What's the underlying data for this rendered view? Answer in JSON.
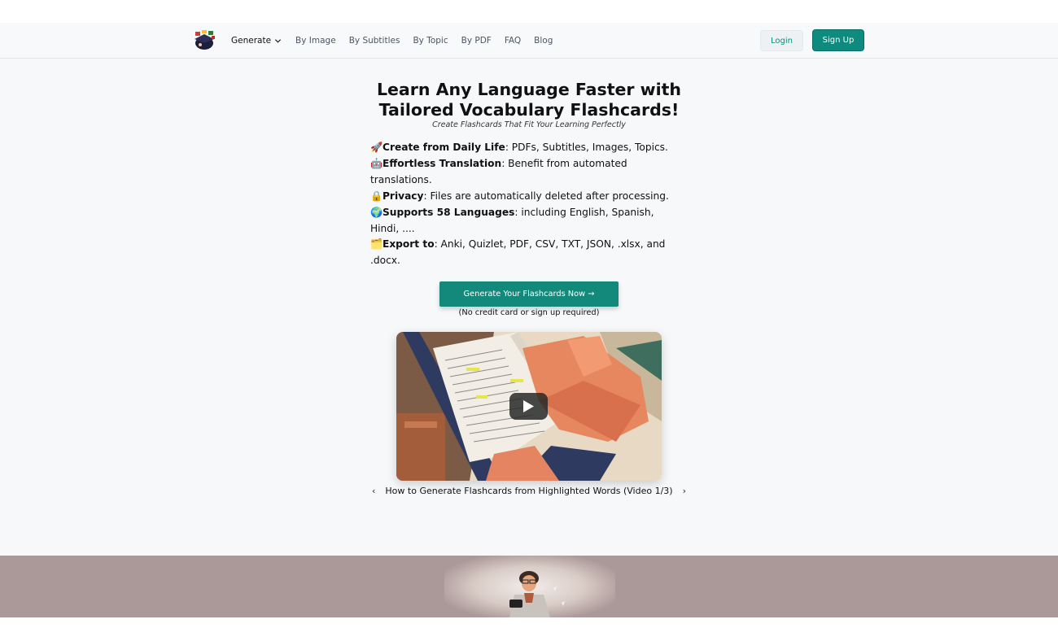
{
  "nav": {
    "generate_label": "Generate",
    "links": [
      "By Image",
      "By Subtitles",
      "By Topic",
      "By PDF",
      "FAQ",
      "Blog"
    ],
    "login_label": "Login",
    "signup_label": "Sign Up"
  },
  "hero": {
    "title_line1": "Learn Any Language Faster with",
    "title_line2": "Tailored Vocabulary Flashcards!",
    "subtitle": "Create Flashcards That Fit Your Learning Perfectly"
  },
  "features": [
    {
      "icon": "🚀",
      "icon_name": "rocket-icon",
      "bold": "Create from Daily Life",
      "text": ": PDFs, Subtitles, Images, Topics."
    },
    {
      "icon": "🤖",
      "icon_name": "robot-icon",
      "bold": "Effortless Translation",
      "text": ": Benefit from automated translations."
    },
    {
      "icon": "🔒",
      "icon_name": "lock-icon",
      "bold": "Privacy",
      "text": ": Files are automatically deleted after processing."
    },
    {
      "icon": "🌍",
      "icon_name": "globe-icon",
      "bold": "Supports 58 Languages",
      "text": ": including English, Spanish, Hindi, ...."
    },
    {
      "icon": "🗂️",
      "icon_name": "card-index-icon",
      "bold": "Export to",
      "text": ": Anki, Quizlet, PDF, CSV, TXT, JSON, .xlsx, and .docx."
    }
  ],
  "cta": {
    "label": "Generate Your Flashcards Now →",
    "note": "(No credit card or sign up required)"
  },
  "video": {
    "caption": "How to Generate Flashcards from Highlighted Words (Video 1/3)",
    "prev": "‹",
    "next": "›"
  },
  "colors": {
    "accent": "#0e8b7e",
    "footer_band": "#ab9898"
  }
}
